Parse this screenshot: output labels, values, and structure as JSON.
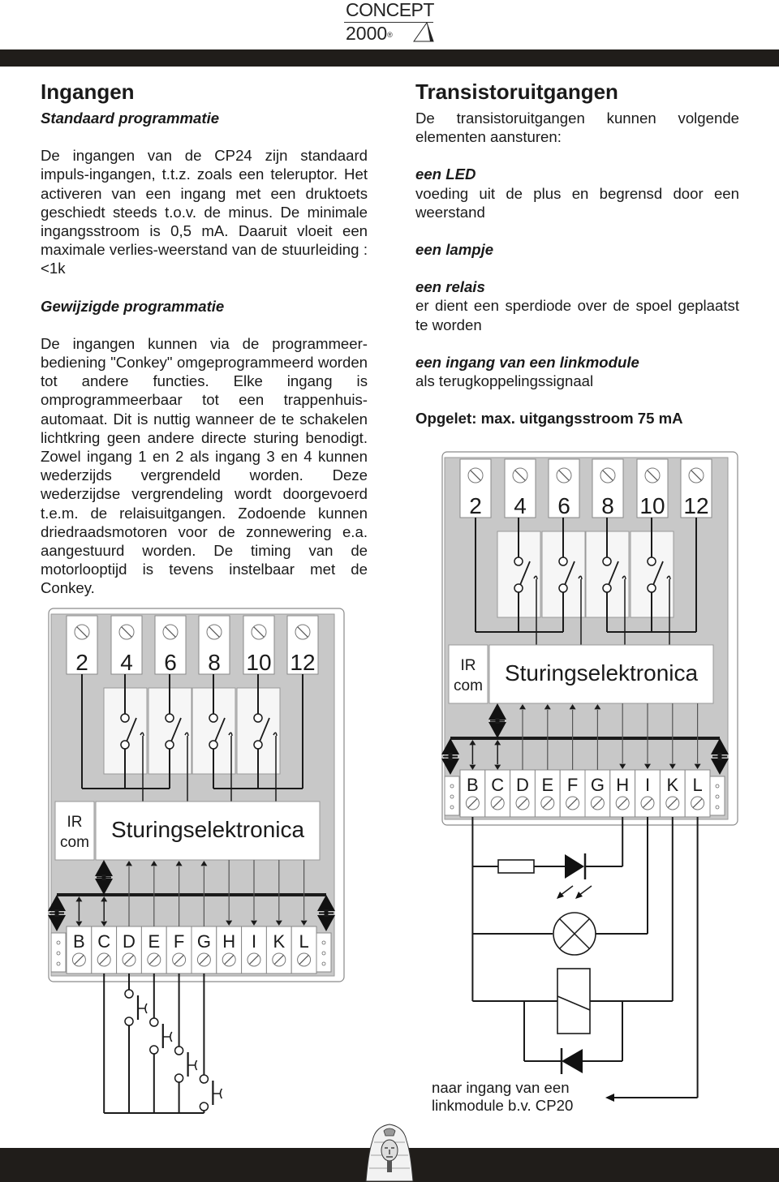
{
  "brand": {
    "line1": "CONCEPT",
    "line2": "2000",
    "registered": "®"
  },
  "left": {
    "title": "Ingangen",
    "section1_title": "Standaard programmatie",
    "section1_text": "De ingangen van de CP24 zijn standaard impuls-ingangen, t.t.z. zoals een teleruptor. Het activeren van een ingang met een druktoets geschiedt steeds t.o.v. de minus. De minimale ingangsstroom is 0,5 mA. Daaruit vloeit een maximale verlies-weerstand van de stuurleiding : <1k",
    "section2_title": "Gewijzigde programmatie",
    "section2_text": "De ingangen kunnen via de programmeer-bediening \"Conkey\" omgeprogrammeerd worden tot andere functies. Elke ingang is omprogrammeerbaar tot een trappenhuis-automaat. Dit is nuttig wanneer de te schakelen lichtkring geen andere directe sturing benodigt. Zowel ingang 1 en 2 als ingang 3 en 4 kunnen wederzijds vergrendeld worden. Deze wederzijdse vergrendeling wordt doorgevoerd t.e.m. de relaisuitgangen. Zodoende kunnen driedraadsmotoren voor de zonnewering e.a. aangestuurd worden. De timing van de motorlooptijd is tevens instelbaar met de Conkey."
  },
  "right": {
    "title": "Transistoruitgangen",
    "intro": "De transistoruitgangen kunnen volgende elementen aansturen:",
    "items": [
      {
        "title": "een LED",
        "text": "voeding uit de plus en begrensd door een weerstand"
      },
      {
        "title": "een lampje",
        "text": ""
      },
      {
        "title": "een relais",
        "text": "er dient een sperdiode over de spoel geplaatst te worden"
      },
      {
        "title": "een ingang van een linkmodule",
        "text": "als terugkoppelingssignaal"
      }
    ],
    "warning": "Opgelet: max. uitgangsstroom 75 mA"
  },
  "diagram": {
    "top_terminals": [
      "2",
      "4",
      "6",
      "8",
      "10",
      "12"
    ],
    "ir_label_line1": "IR",
    "ir_label_line2": "com",
    "controller_label": "Sturingselektronica",
    "bottom_terminals": [
      "B",
      "C",
      "D",
      "E",
      "F",
      "G",
      "H",
      "I",
      "K",
      "L"
    ],
    "side_dots": "o o o"
  },
  "right_annotation": {
    "line1": "naar ingang van een",
    "line2": "linkmodule b.v. CP20"
  },
  "colors": {
    "bar": "#201d1a",
    "panel_gray": "#c8c8c8",
    "terminal_white": "#ffffff",
    "line": "#1a1a1a"
  }
}
